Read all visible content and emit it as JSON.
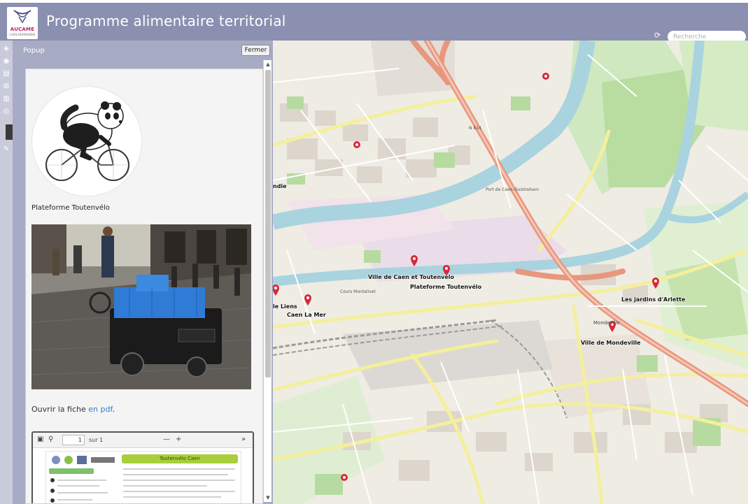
{
  "app": {
    "title": "Programme alimentaire territorial",
    "logo_brand": "AUCAME",
    "logo_sub": "CAEN NORMANDIE"
  },
  "search": {
    "placeholder": "Recherche"
  },
  "popup": {
    "title": "Popup",
    "close_label": "Fermer",
    "place_name": "Plateforme Toutenvélo",
    "pdf_text": "Ouvrir la fiche ",
    "pdf_link": "en pdf",
    "pdf_suffix": ".",
    "pdf_viewer": {
      "page_value": "1",
      "page_total": "sur 1",
      "zoom_out": "—",
      "zoom_in": "+",
      "more": "»",
      "banner": "Toutenvélo Caen"
    }
  },
  "map": {
    "markers": [
      {
        "label": "Ville de Caen et Toutenvélo"
      },
      {
        "label": "Plateforme Toutenvélo"
      },
      {
        "label": "Les jardins d'Arlette"
      },
      {
        "label": "Ville de Mondeville"
      },
      {
        "label": "Caen La Mer"
      },
      {
        "label": "le Liens"
      },
      {
        "label": "ndie"
      }
    ],
    "places": [
      "Mondeville",
      "Port de Caen-Ouistreham",
      "N 814",
      "Cours Montalivet"
    ]
  },
  "colors": {
    "header": "#8b8fb0",
    "panel": "#a7abc4",
    "marker": "#d6293a",
    "water": "#a9d3df",
    "major_road": "#e8977e",
    "secondary_road": "#f6f3a8"
  },
  "icons": [
    "refresh-icon",
    "search-icon",
    "layers-icon",
    "info-icon",
    "map-icon",
    "measure-icon",
    "print-icon",
    "sidebar-icon",
    "zoom-icon"
  ]
}
